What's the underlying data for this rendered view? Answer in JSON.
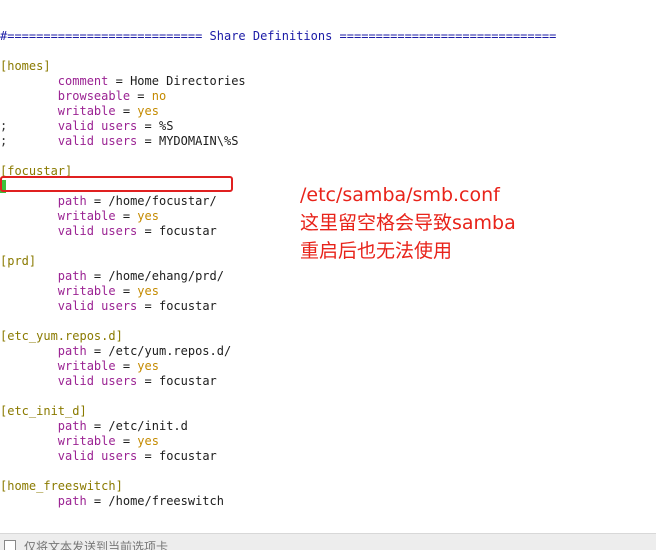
{
  "lines": [
    {
      "kind": "header",
      "text": "#=========================== Share Definitions =============================="
    },
    {
      "kind": "blank"
    },
    {
      "kind": "section",
      "text": "[homes]"
    },
    {
      "kind": "kv",
      "prefix": "",
      "key": "comment",
      "value": "Home Directories",
      "vstyle": "text"
    },
    {
      "kind": "kv",
      "prefix": "",
      "key": "browseable",
      "value": "no",
      "vstyle": "orange"
    },
    {
      "kind": "kv",
      "prefix": "",
      "key": "writable",
      "value": "yes",
      "vstyle": "orange"
    },
    {
      "kind": "kv",
      "prefix": ";",
      "key": "valid users",
      "value": "%S",
      "vstyle": "text"
    },
    {
      "kind": "kv",
      "prefix": ";",
      "key": "valid users",
      "value": "MYDOMAIN\\%S",
      "vstyle": "text"
    },
    {
      "kind": "blank"
    },
    {
      "kind": "section",
      "text": "[focustar]"
    },
    {
      "kind": "cursor"
    },
    {
      "kind": "kv",
      "prefix": "",
      "key": "path",
      "value": "/home/focustar/",
      "vstyle": "text"
    },
    {
      "kind": "kv",
      "prefix": "",
      "key": "writable",
      "value": "yes",
      "vstyle": "orange"
    },
    {
      "kind": "kv",
      "prefix": "",
      "key": "valid users",
      "value": "focustar",
      "vstyle": "text"
    },
    {
      "kind": "blank"
    },
    {
      "kind": "section",
      "text": "[prd]"
    },
    {
      "kind": "kv",
      "prefix": "",
      "key": "path",
      "value": "/home/ehang/prd/",
      "vstyle": "text"
    },
    {
      "kind": "kv",
      "prefix": "",
      "key": "writable",
      "value": "yes",
      "vstyle": "orange"
    },
    {
      "kind": "kv",
      "prefix": "",
      "key": "valid users",
      "value": "focustar",
      "vstyle": "text"
    },
    {
      "kind": "blank"
    },
    {
      "kind": "section",
      "text": "[etc_yum.repos.d]"
    },
    {
      "kind": "kv",
      "prefix": "",
      "key": "path",
      "value": "/etc/yum.repos.d/",
      "vstyle": "text"
    },
    {
      "kind": "kv",
      "prefix": "",
      "key": "writable",
      "value": "yes",
      "vstyle": "orange"
    },
    {
      "kind": "kv",
      "prefix": "",
      "key": "valid users",
      "value": "focustar",
      "vstyle": "text"
    },
    {
      "kind": "blank"
    },
    {
      "kind": "section",
      "text": "[etc_init_d]"
    },
    {
      "kind": "kv",
      "prefix": "",
      "key": "path",
      "value": "/etc/init.d",
      "vstyle": "text"
    },
    {
      "kind": "kv",
      "prefix": "",
      "key": "writable",
      "value": "yes",
      "vstyle": "orange"
    },
    {
      "kind": "kv",
      "prefix": "",
      "key": "valid users",
      "value": "focustar",
      "vstyle": "text"
    },
    {
      "kind": "blank"
    },
    {
      "kind": "section",
      "text": "[home_freeswitch]"
    },
    {
      "kind": "kv",
      "prefix": "",
      "key": "path",
      "value": "/home/freeswitch",
      "vstyle": "text"
    }
  ],
  "annotation": {
    "line1": "/etc/samba/smb.conf",
    "line2": "这里留空格会导致samba",
    "line3": "重启后也无法使用"
  },
  "bottombar": {
    "label": "仅将文本发送到当前选项卡"
  },
  "colors": {
    "header": "#1a1aa6",
    "section": "#8a7a00",
    "key": "#9b2393",
    "value_keyword": "#c48a00",
    "annotation": "#e8231a",
    "highlight_box": "#e02020",
    "cursor": "#3cc03c"
  }
}
